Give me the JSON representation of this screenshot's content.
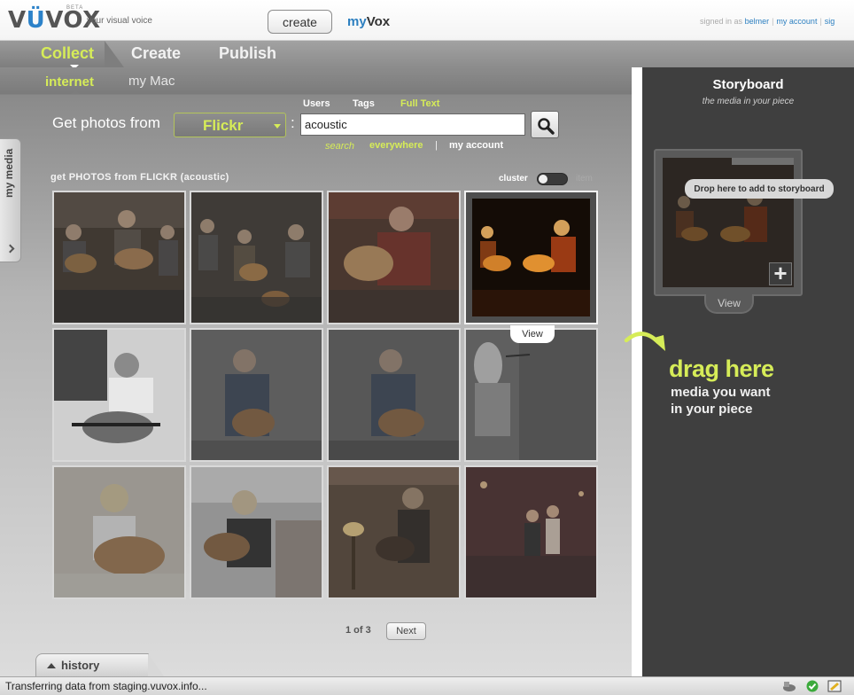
{
  "header": {
    "logo_pre": "V",
    "logo_accent": "Ü",
    "logo_post": "VOX",
    "beta": "BETA",
    "tagline": "your visual voice",
    "create_button": "create",
    "myvox_my": "my",
    "myvox_vox": "Vox",
    "signed_in_prefix": "signed in as",
    "username": "belmer",
    "my_account_link": "my account",
    "sign_link": "sig"
  },
  "main_tabs": [
    {
      "label": "Collect",
      "active": true
    },
    {
      "label": "Create",
      "active": false
    },
    {
      "label": "Publish",
      "active": false
    }
  ],
  "sub_tabs": [
    {
      "label": "internet",
      "active": true
    },
    {
      "label": "my Mac",
      "active": false
    }
  ],
  "search": {
    "label": "Get photos from",
    "source": "Flickr",
    "colon": ":",
    "modes": [
      "Users",
      "Tags",
      "Full Text"
    ],
    "active_mode": "Full Text",
    "query": "acoustic",
    "scope_search": "search",
    "scope_everywhere": "everywhere",
    "scope_separator": "|",
    "scope_my_account": "my account"
  },
  "results": {
    "title": "get PHOTOS from FLICKR (acoustic)",
    "cluster_label": "cluster",
    "item_label": "item",
    "view_tooltip": "View",
    "page_text": "1 of 3",
    "next_button": "Next"
  },
  "side_tabs": {
    "my_media": "my media",
    "history": "history"
  },
  "storyboard": {
    "title": "Storyboard",
    "subtitle": "the media in your piece",
    "drop_tooltip": "Drop here to add to storyboard",
    "plus": "+",
    "view": "View",
    "drag_here": "drag here",
    "drag_desc_line1": "media you want",
    "drag_desc_line2": "in your piece"
  },
  "status_bar": {
    "text": "Transferring data from staging.vuvox.info..."
  },
  "colors": {
    "accent_green": "#d6ec58",
    "link_blue": "#2c7fc0",
    "panel_dark": "#3f3f3f"
  }
}
